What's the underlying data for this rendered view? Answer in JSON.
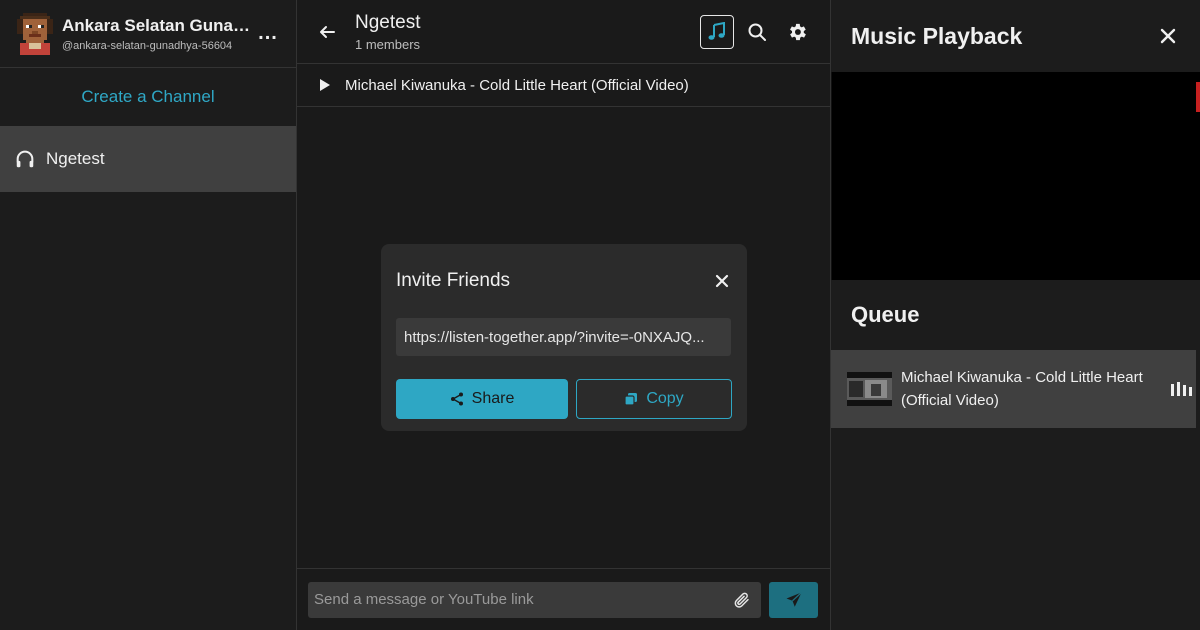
{
  "sidebar": {
    "user": {
      "name": "Ankara Selatan Gunad...",
      "handle": "@ankara-selatan-gunadhya-56604"
    },
    "more_label": "...",
    "create_channel_label": "Create a Channel",
    "channels": [
      {
        "label": "Ngetest",
        "icon": "headphones-icon",
        "active": true
      }
    ]
  },
  "chat": {
    "title": "Ngetest",
    "subtitle": "1 members",
    "now_playing": "Michael Kiwanuka - Cold Little Heart (Official Video)",
    "composer": {
      "placeholder": "Send a message or YouTube link"
    }
  },
  "modal": {
    "title": "Invite Friends",
    "invite_link": "https://listen-together.app/?invite=-0NXAJQ...",
    "share_label": "Share",
    "copy_label": "Copy"
  },
  "right_panel": {
    "title": "Music Playback",
    "queue_title": "Queue",
    "queue": [
      {
        "title": "Michael Kiwanuka - Cold Little Heart (Official Video)"
      }
    ]
  },
  "colors": {
    "accent": "#2ea7c4",
    "send_button": "#1d6f80",
    "active_row": "#404040",
    "background": "#1a1a1a"
  }
}
